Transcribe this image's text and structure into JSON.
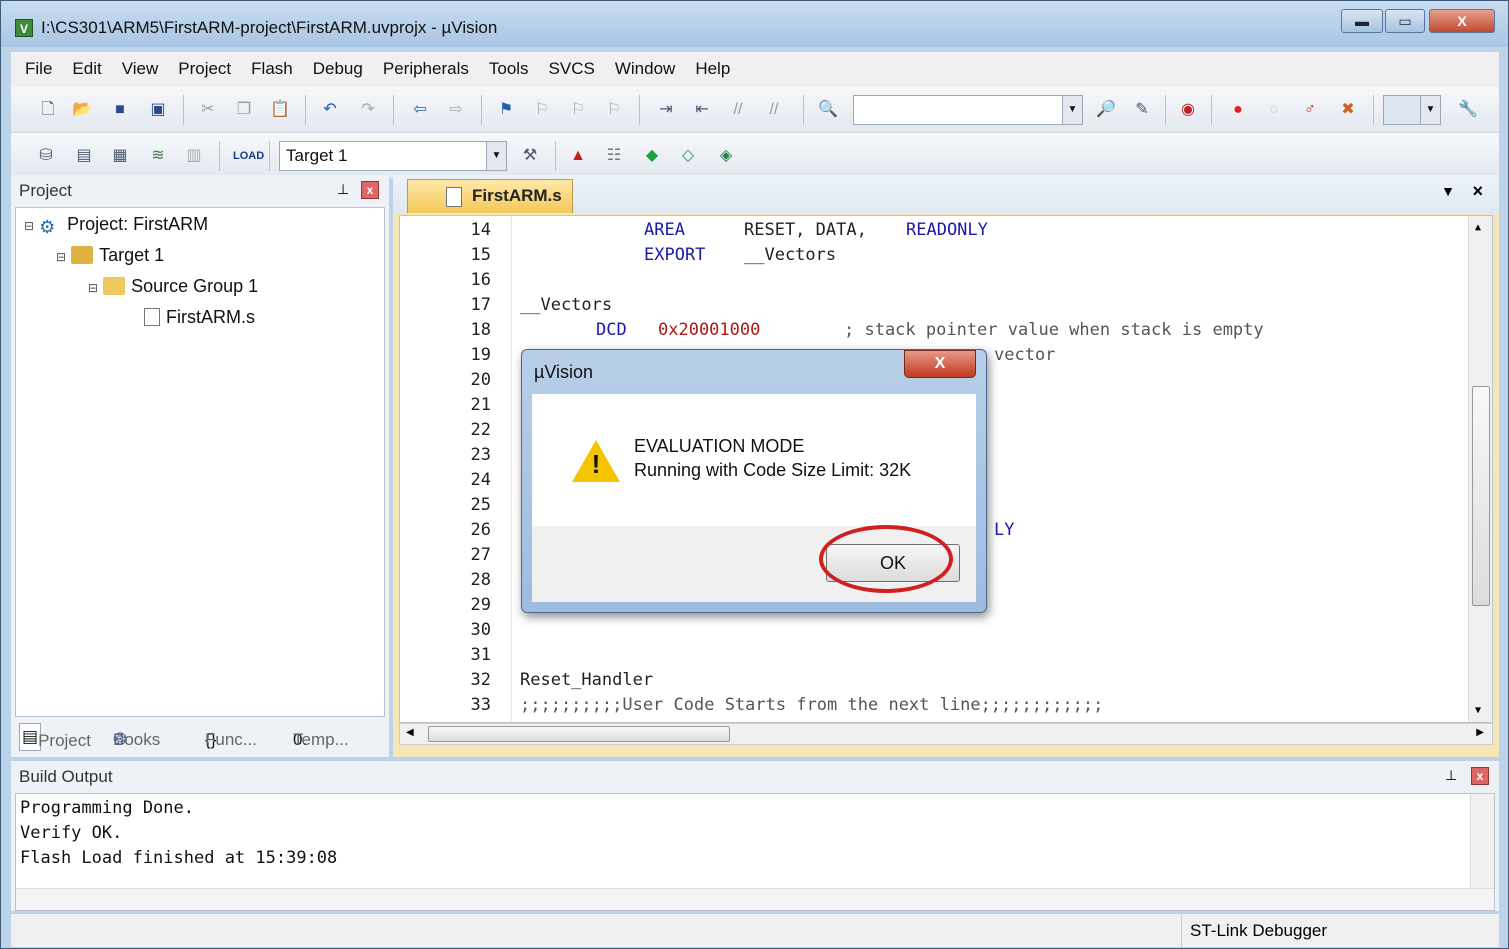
{
  "window": {
    "title": "I:\\CS301\\ARM5\\FirstARM-project\\FirstARM.uvprojx - µVision",
    "minimize": "▬",
    "maximize": "▭",
    "close": "X"
  },
  "menu": [
    "File",
    "Edit",
    "View",
    "Project",
    "Flash",
    "Debug",
    "Peripherals",
    "Tools",
    "SVCS",
    "Window",
    "Help"
  ],
  "toolbar2": {
    "target_combo": "Target 1"
  },
  "project_panel": {
    "header": "Project",
    "tree": {
      "project": "Project: FirstARM",
      "target": "Target 1",
      "group": "Source Group 1",
      "file": "FirstARM.s"
    },
    "tabs": [
      "Project",
      "Books",
      "Func...",
      "Temp..."
    ]
  },
  "editor": {
    "tab": "FirstARM.s",
    "lines": [
      {
        "n": "14",
        "text": ""
      },
      {
        "n": "15",
        "text": ""
      },
      {
        "n": "16",
        "text": ""
      },
      {
        "n": "17",
        "text": "__Vectors"
      },
      {
        "n": "18",
        "text": ""
      },
      {
        "n": "19",
        "text": ""
      },
      {
        "n": "20",
        "text": ""
      },
      {
        "n": "21",
        "text": ""
      },
      {
        "n": "22",
        "text": ""
      },
      {
        "n": "23",
        "text": ""
      },
      {
        "n": "24",
        "text": ""
      },
      {
        "n": "25",
        "text": ""
      },
      {
        "n": "26",
        "text": ""
      },
      {
        "n": "27",
        "text": ""
      },
      {
        "n": "28",
        "text": ""
      },
      {
        "n": "29",
        "text": ""
      },
      {
        "n": "30",
        "text": ""
      },
      {
        "n": "31",
        "text": ""
      },
      {
        "n": "32",
        "text": "Reset_Handler"
      },
      {
        "n": "33",
        "text": ";;;;;;;;;;User Code Starts from the next line;;;;;;;;;;;;"
      }
    ],
    "l14": {
      "kw": "AREA",
      "rest": "RESET, DATA, ",
      "kw2": "READONLY"
    },
    "l15": {
      "kw": "EXPORT",
      "rest": "__Vectors"
    },
    "l18": {
      "kw": "DCD",
      "num": "0x20001000",
      "comment": "; stack pointer value when stack is empty"
    },
    "l19_tail": "vector",
    "l26_tail": "LY"
  },
  "build_output": {
    "header": "Build Output",
    "lines": [
      "Programming Done.",
      "Verify OK.",
      "Flash Load finished at 15:39:08"
    ]
  },
  "status": {
    "debugger": "ST-Link Debugger"
  },
  "dialog": {
    "title": "µVision",
    "close": "X",
    "message_line1": "EVALUATION MODE",
    "message_line2": "Running with Code Size Limit: 32K",
    "ok": "OK"
  }
}
